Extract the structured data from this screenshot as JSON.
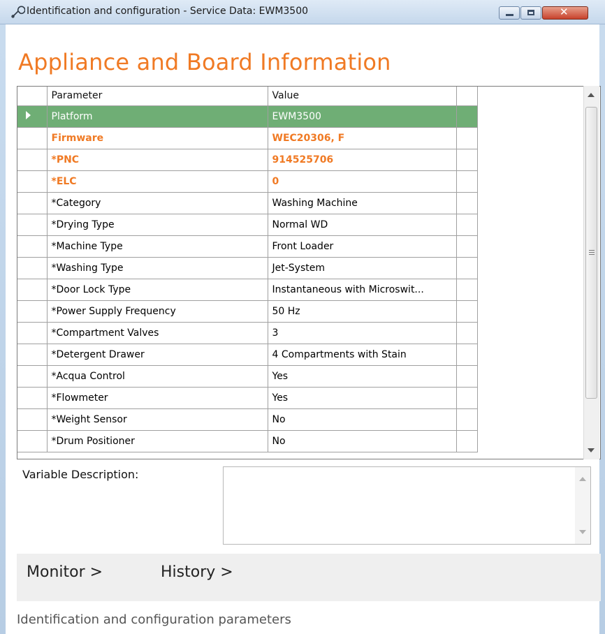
{
  "window": {
    "title": "Identification and configuration - Service Data: EWM3500",
    "icon": "wrench-icon"
  },
  "heading": "Appliance and Board Information",
  "grid": {
    "columns": [
      "Parameter",
      "Value"
    ],
    "rows": [
      {
        "parameter": "Platform",
        "value": "EWM3500"
      },
      {
        "parameter": "Firmware",
        "value": "WEC20306, F"
      },
      {
        "parameter": "*PNC",
        "value": "914525706"
      },
      {
        "parameter": "*ELC",
        "value": "0"
      },
      {
        "parameter": "*Category",
        "value": "Washing Machine"
      },
      {
        "parameter": "*Drying Type",
        "value": "Normal WD"
      },
      {
        "parameter": "*Machine Type",
        "value": "Front Loader"
      },
      {
        "parameter": "*Washing Type",
        "value": "Jet-System"
      },
      {
        "parameter": "*Door Lock Type",
        "value": "Instantaneous with Microswit..."
      },
      {
        "parameter": "*Power Supply Frequency",
        "value": "50 Hz"
      },
      {
        "parameter": "*Compartment Valves",
        "value": "3"
      },
      {
        "parameter": "*Detergent Drawer",
        "value": "4 Compartments with Stain"
      },
      {
        "parameter": "*Acqua Control",
        "value": "Yes"
      },
      {
        "parameter": "*Flowmeter",
        "value": "Yes"
      },
      {
        "parameter": "*Weight Sensor",
        "value": "No"
      },
      {
        "parameter": "*Drum Positioner",
        "value": "No"
      }
    ]
  },
  "variable_description": {
    "label": "Variable Description:",
    "value": ""
  },
  "nav": {
    "monitor": "Monitor >",
    "history": "History >"
  },
  "footer": "Identification and configuration parameters",
  "colors": {
    "accent": "#f07a24",
    "selected_row": "#6fae75"
  }
}
